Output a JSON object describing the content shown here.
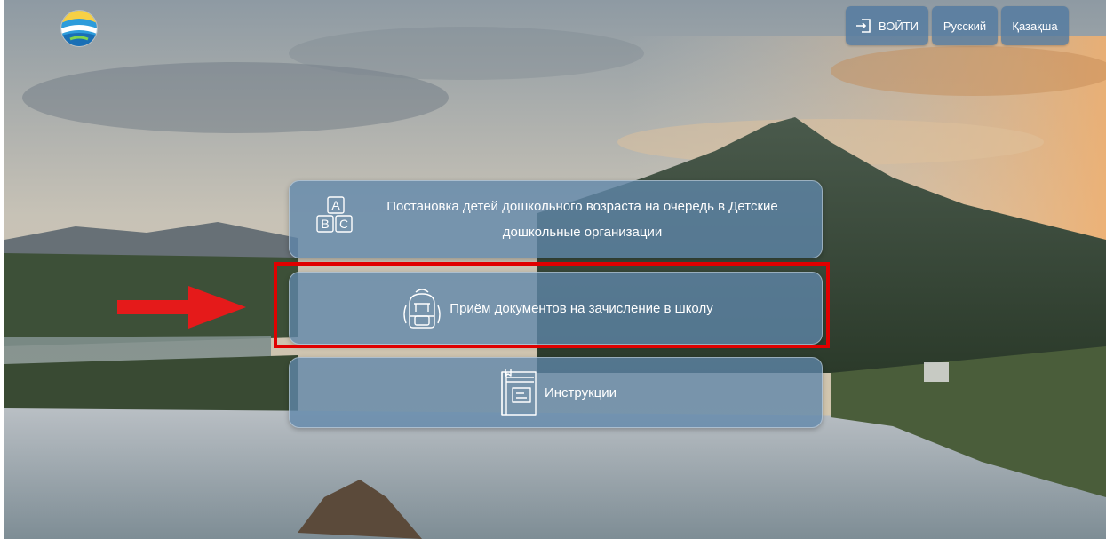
{
  "header": {
    "login_label": "ВОЙТИ",
    "lang_ru": "Русский",
    "lang_kz": "Қазақша"
  },
  "cards": [
    {
      "title": "Постановка детей дошкольного возраста на очередь в Детские дошкольные организации",
      "icon": "abc-blocks-icon"
    },
    {
      "title": "Приём документов на зачисление в школу",
      "icon": "backpack-icon"
    },
    {
      "title": "Инструкции",
      "icon": "book-icon"
    }
  ],
  "icons": {
    "abc_letters": [
      "A",
      "B",
      "C"
    ]
  },
  "colors": {
    "card_bg": "#5f87aa",
    "button_bg": "#5078a0",
    "highlight": "#e00000"
  }
}
